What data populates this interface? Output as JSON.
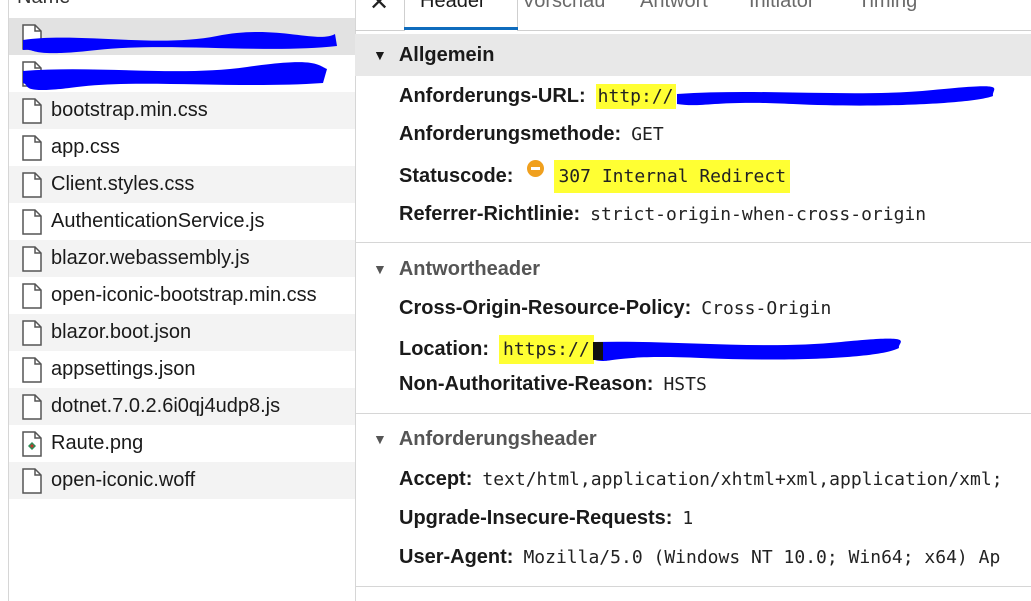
{
  "file_list": {
    "column_header": "Name",
    "items": [
      {
        "label": "",
        "redacted": true
      },
      {
        "label": "",
        "redacted": true
      },
      {
        "label": "bootstrap.min.css",
        "icon": "document-icon"
      },
      {
        "label": "app.css",
        "icon": "document-icon"
      },
      {
        "label": "Client.styles.css",
        "icon": "document-icon"
      },
      {
        "label": "AuthenticationService.js",
        "icon": "document-icon"
      },
      {
        "label": "blazor.webassembly.js",
        "icon": "document-icon"
      },
      {
        "label": "open-iconic-bootstrap.min.css",
        "icon": "document-icon"
      },
      {
        "label": "blazor.boot.json",
        "icon": "document-icon"
      },
      {
        "label": "appsettings.json",
        "icon": "document-icon"
      },
      {
        "label": "dotnet.7.0.2.6i0qj4udp8.js",
        "icon": "document-icon"
      },
      {
        "label": "Raute.png",
        "icon": "image-file-icon"
      },
      {
        "label": "open-iconic.woff",
        "icon": "document-icon"
      }
    ]
  },
  "tabs": {
    "close": "✕",
    "items": [
      "Header",
      "Vorschau",
      "Antwort",
      "Initiator",
      "Timing"
    ],
    "active": "Header"
  },
  "general": {
    "title": "Allgemein",
    "request_url_key": "Anforderungs-URL:",
    "request_url_value": "http://",
    "method_key": "Anforderungsmethode:",
    "method_value": "GET",
    "status_key": "Statuscode:",
    "status_value": "307 Internal Redirect",
    "referrer_key": "Referrer-Richtlinie:",
    "referrer_value": "strict-origin-when-cross-origin"
  },
  "response_headers": {
    "title": "Antwortheader",
    "corp_key": "Cross-Origin-Resource-Policy:",
    "corp_value": "Cross-Origin",
    "location_key": "Location:",
    "location_value": "https://",
    "nar_key": "Non-Authoritative-Reason:",
    "nar_value": "HSTS"
  },
  "request_headers": {
    "title": "Anforderungsheader",
    "accept_key": "Accept:",
    "accept_value": "text/html,application/xhtml+xml,application/xml;",
    "uir_key": "Upgrade-Insecure-Requests:",
    "uir_value": "1",
    "ua_key": "User-Agent:",
    "ua_value": "Mozilla/5.0 (Windows NT 10.0; Win64; x64) Ap"
  },
  "colors": {
    "highlight": "#ffff33",
    "redaction": "#0000ff",
    "accent": "#0f6cbd",
    "status_warning": "#f0a01e"
  }
}
